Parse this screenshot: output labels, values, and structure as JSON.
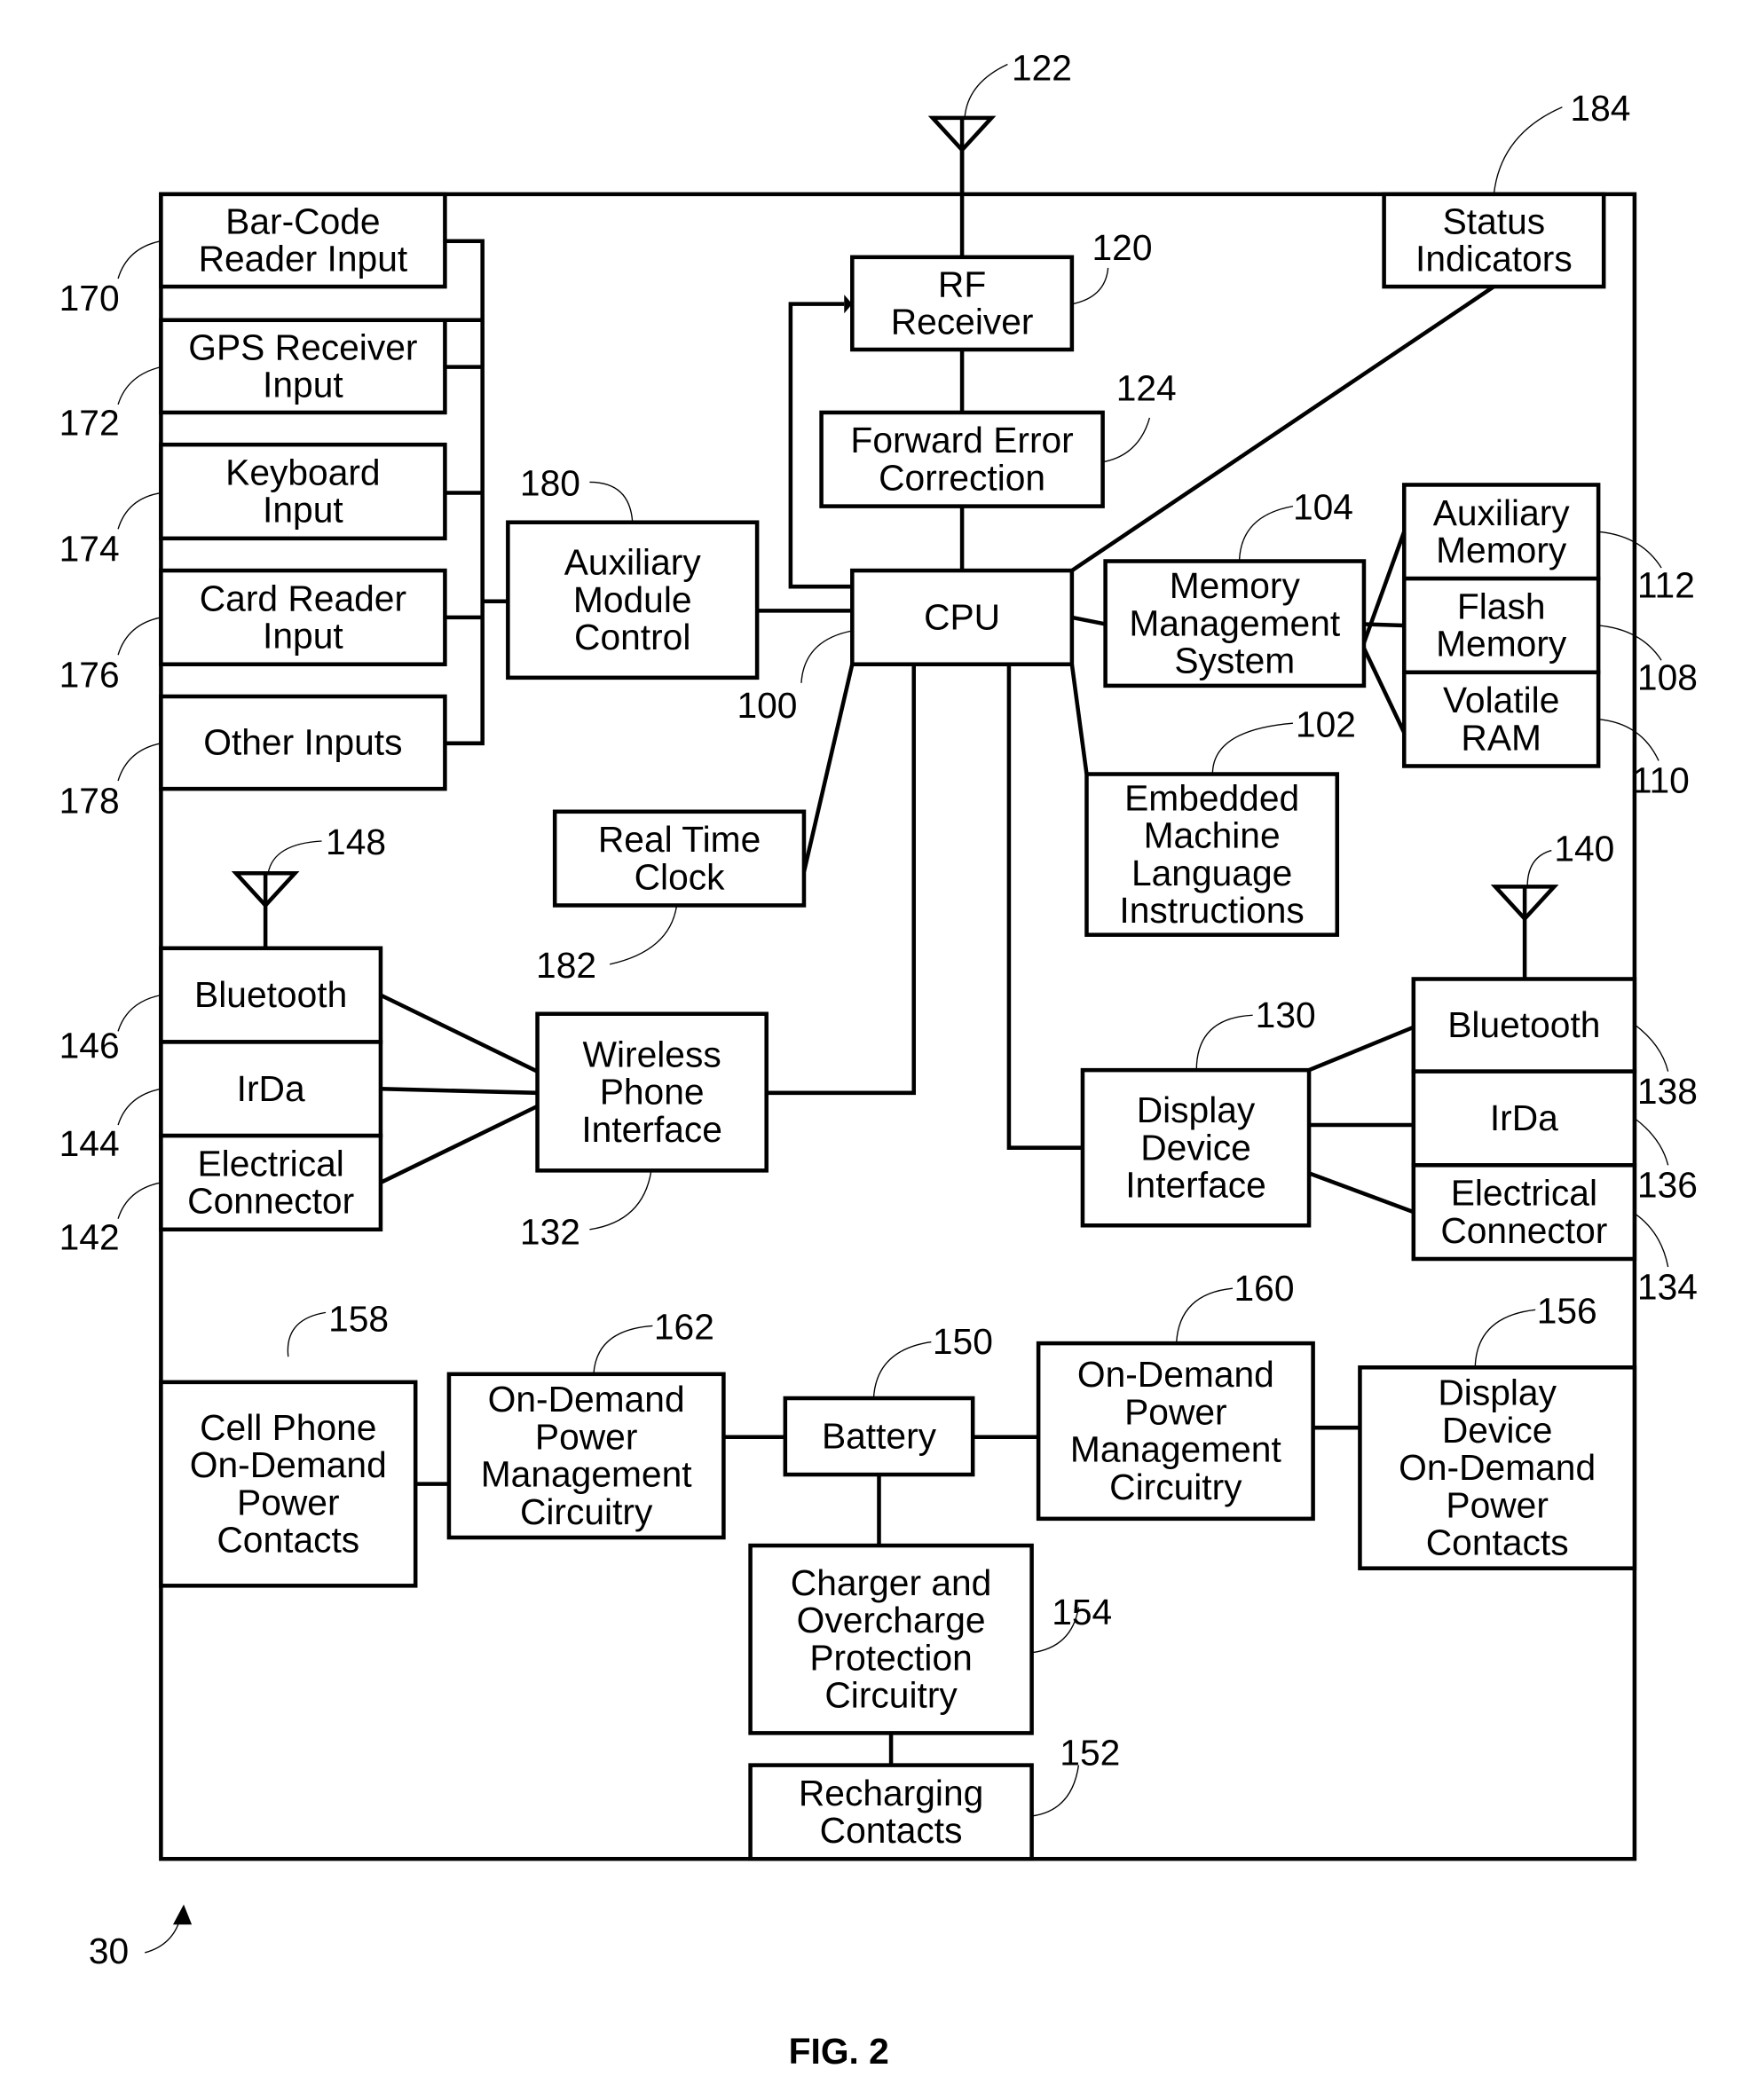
{
  "figure": {
    "caption": "FIG. 2",
    "device_ref": "30"
  },
  "blocks": [
    {
      "id": "barcode",
      "ref": "170",
      "lines": [
        "Bar-Code",
        "Reader Input"
      ]
    },
    {
      "id": "gps",
      "ref": "172",
      "lines": [
        "GPS Receiver",
        "Input"
      ]
    },
    {
      "id": "keyboard",
      "ref": "174",
      "lines": [
        "Keyboard",
        "Input"
      ]
    },
    {
      "id": "cardreader",
      "ref": "176",
      "lines": [
        "Card Reader",
        "Input"
      ]
    },
    {
      "id": "otherinputs",
      "ref": "178",
      "lines": [
        "Other Inputs"
      ]
    },
    {
      "id": "auxmodule",
      "ref": "180",
      "lines": [
        "Auxiliary",
        "Module",
        "Control"
      ]
    },
    {
      "id": "cpu",
      "ref": "100",
      "lines": [
        "CPU"
      ]
    },
    {
      "id": "rf",
      "ref": "120",
      "lines": [
        "RF",
        "Receiver"
      ]
    },
    {
      "id": "fec",
      "ref": "124",
      "lines": [
        "Forward Error",
        "Correction"
      ]
    },
    {
      "id": "status",
      "ref": "184",
      "lines": [
        "Status",
        "Indicators"
      ]
    },
    {
      "id": "mms",
      "ref": "104",
      "lines": [
        "Memory",
        "Management",
        "System"
      ]
    },
    {
      "id": "auxmem",
      "ref": "112",
      "lines": [
        "Auxiliary",
        "Memory"
      ]
    },
    {
      "id": "flash",
      "ref": "108",
      "lines": [
        "Flash",
        "Memory"
      ]
    },
    {
      "id": "ram",
      "ref": "110",
      "lines": [
        "Volatile",
        "RAM"
      ]
    },
    {
      "id": "embedded",
      "ref": "102",
      "lines": [
        "Embedded",
        "Machine",
        "Language",
        "Instructions"
      ]
    },
    {
      "id": "rtc",
      "ref": "182",
      "lines": [
        "Real Time",
        "Clock"
      ]
    },
    {
      "id": "bt_left",
      "ref": "146",
      "lines": [
        "Bluetooth"
      ]
    },
    {
      "id": "irda_left",
      "ref": "144",
      "lines": [
        "IrDa"
      ]
    },
    {
      "id": "elec_left",
      "ref": "142",
      "lines": [
        "Electrical",
        "Connector"
      ]
    },
    {
      "id": "wpi",
      "ref": "132",
      "lines": [
        "Wireless",
        "Phone",
        "Interface"
      ]
    },
    {
      "id": "ddi",
      "ref": "130",
      "lines": [
        "Display",
        "Device",
        "Interface"
      ]
    },
    {
      "id": "bt_right",
      "ref": "138",
      "lines": [
        "Bluetooth"
      ]
    },
    {
      "id": "irda_right",
      "ref": "136",
      "lines": [
        "IrDa"
      ]
    },
    {
      "id": "elec_right",
      "ref": "134",
      "lines": [
        "Electrical",
        "Connector"
      ]
    },
    {
      "id": "cellcontacts",
      "ref": "158",
      "lines": [
        "Cell Phone",
        "On-Demand",
        "Power",
        "Contacts"
      ]
    },
    {
      "id": "odpm_left",
      "ref": "162",
      "lines": [
        "On-Demand",
        "Power",
        "Management",
        "Circuitry"
      ]
    },
    {
      "id": "battery",
      "ref": "150",
      "lines": [
        "Battery"
      ]
    },
    {
      "id": "odpm_right",
      "ref": "160",
      "lines": [
        "On-Demand",
        "Power",
        "Management",
        "Circuitry"
      ]
    },
    {
      "id": "ddcontacts",
      "ref": "156",
      "lines": [
        "Display",
        "Device",
        "On-Demand",
        "Power",
        "Contacts"
      ]
    },
    {
      "id": "charger",
      "ref": "154",
      "lines": [
        "Charger and",
        "Overcharge",
        "Protection",
        "Circuitry"
      ]
    },
    {
      "id": "recharging",
      "ref": "152",
      "lines": [
        "Recharging",
        "Contacts"
      ]
    }
  ],
  "antennas": [
    {
      "id": "antenna_rf",
      "ref": "122"
    },
    {
      "id": "antenna_left",
      "ref": "148"
    },
    {
      "id": "antenna_right",
      "ref": "140"
    }
  ]
}
